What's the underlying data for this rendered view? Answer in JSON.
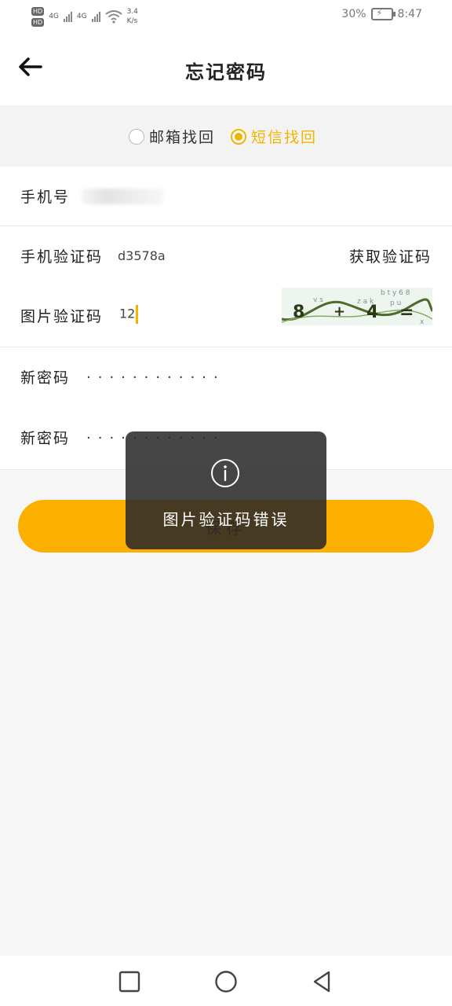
{
  "status_bar": {
    "hd1": "HD",
    "hd2": "HD",
    "net1": "4G",
    "net2": "4G",
    "speed_value": "3.4",
    "speed_unit": "K/s",
    "battery": "30%",
    "time": "8:47"
  },
  "header": {
    "title": "忘记密码"
  },
  "method": {
    "email_label": "邮箱找回",
    "sms_label": "短信找回",
    "selected": "sms"
  },
  "form": {
    "phone_label": "手机号",
    "sms_code_label": "手机验证码",
    "sms_code_value": "d3578a",
    "get_code_label": "获取验证码",
    "image_code_label": "图片验证码",
    "image_code_value": "12",
    "new_password_label": "新密码",
    "new_password_mask": "············",
    "confirm_password_label": "新密码",
    "confirm_password_mask": "············"
  },
  "save_label": "保存",
  "toast": {
    "message": "图片验证码错误"
  },
  "colors": {
    "accent": "#f5b301",
    "button": "#fbb000",
    "toast_bg": "#282828"
  }
}
